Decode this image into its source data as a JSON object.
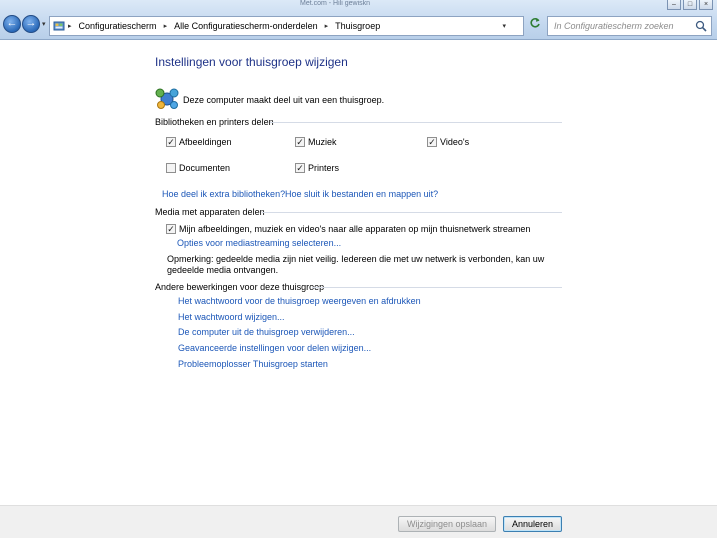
{
  "window": {
    "title": "Met.com - Hili gewiskn"
  },
  "nav": {
    "back_symbol": "←",
    "forward_symbol": "→",
    "dropdown_symbol": "▾"
  },
  "address": {
    "breadcrumbs": [
      "Configuratiescherm",
      "Alle Configuratiescherm-onderdelen",
      "Thuisgroep"
    ],
    "separator": "▸"
  },
  "search": {
    "placeholder": "In Configuratiescherm zoeken"
  },
  "page": {
    "title": "Instellingen voor thuisgroep wijzigen",
    "intro": "Deze computer maakt deel uit van een thuisgroep."
  },
  "libraries": {
    "heading": "Bibliotheken en printers delen",
    "items": [
      {
        "label": "Afbeeldingen",
        "checked": true
      },
      {
        "label": "Muziek",
        "checked": true
      },
      {
        "label": "Video's",
        "checked": true
      },
      {
        "label": "Documenten",
        "checked": false
      },
      {
        "label": "Printers",
        "checked": true
      }
    ],
    "link_extra": "Hoe deel ik extra bibliotheken?",
    "link_exclude": "Hoe sluit ik bestanden en mappen uit?"
  },
  "media": {
    "heading": "Media met apparaten delen",
    "stream_label": "Mijn afbeeldingen, muziek en video's naar alle apparaten op mijn thuisnetwerk streamen",
    "stream_checked": true,
    "options_link": "Opties voor mediastreaming selecteren...",
    "note": "Opmerking: gedeelde media zijn niet veilig. Iedereen die met uw netwerk is verbonden, kan uw gedeelde media ontvangen."
  },
  "other": {
    "heading": "Andere bewerkingen voor deze thuisgroep",
    "links": [
      "Het wachtwoord voor de thuisgroep weergeven en afdrukken",
      "Het wachtwoord wijzigen...",
      "De computer uit de thuisgroep verwijderen...",
      "Geavanceerde instellingen voor delen wijzigen...",
      "Probleemoplosser Thuisgroep starten"
    ]
  },
  "footer": {
    "save_label": "Wijzigingen opslaan",
    "cancel_label": "Annuleren"
  }
}
